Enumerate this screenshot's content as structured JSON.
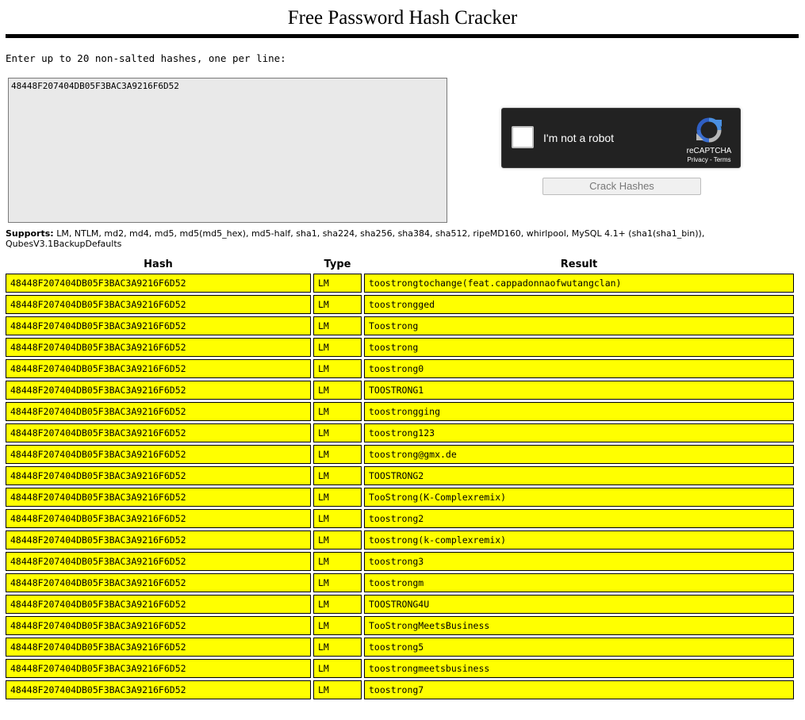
{
  "page": {
    "title": "Free Password Hash Cracker",
    "instructions": "Enter up to 20 non-salted hashes, one per line:"
  },
  "input": {
    "value": "48448F207404DB05F3BAC3A9216F6D52"
  },
  "recaptcha": {
    "label": "I'm not a robot",
    "brand": "reCAPTCHA",
    "privacy": "Privacy",
    "separator": " - ",
    "terms": "Terms",
    "icon": "recaptcha-logo-icon"
  },
  "crack_button": {
    "label": "Crack Hashes"
  },
  "supports": {
    "label": "Supports:",
    "list": " LM, NTLM, md2, md4, md5, md5(md5_hex), md5-half, sha1, sha224, sha256, sha384, sha512, ripeMD160, whirlpool, MySQL 4.1+ (sha1(sha1_bin)), QubesV3.1BackupDefaults"
  },
  "table": {
    "headers": [
      "Hash",
      "Type",
      "Result"
    ],
    "row_color": "#ffff00",
    "rows": [
      {
        "hash": "48448F207404DB05F3BAC3A9216F6D52",
        "type": "LM",
        "result": "toostrongtochange(feat.cappadonnaofwutangclan)"
      },
      {
        "hash": "48448F207404DB05F3BAC3A9216F6D52",
        "type": "LM",
        "result": "toostrongged"
      },
      {
        "hash": "48448F207404DB05F3BAC3A9216F6D52",
        "type": "LM",
        "result": "Toostrong"
      },
      {
        "hash": "48448F207404DB05F3BAC3A9216F6D52",
        "type": "LM",
        "result": "toostrong"
      },
      {
        "hash": "48448F207404DB05F3BAC3A9216F6D52",
        "type": "LM",
        "result": "toostrong0"
      },
      {
        "hash": "48448F207404DB05F3BAC3A9216F6D52",
        "type": "LM",
        "result": "TOOSTRONG1"
      },
      {
        "hash": "48448F207404DB05F3BAC3A9216F6D52",
        "type": "LM",
        "result": "toostrongging"
      },
      {
        "hash": "48448F207404DB05F3BAC3A9216F6D52",
        "type": "LM",
        "result": "toostrong123"
      },
      {
        "hash": "48448F207404DB05F3BAC3A9216F6D52",
        "type": "LM",
        "result": "toostrong@gmx.de"
      },
      {
        "hash": "48448F207404DB05F3BAC3A9216F6D52",
        "type": "LM",
        "result": "TOOSTRONG2"
      },
      {
        "hash": "48448F207404DB05F3BAC3A9216F6D52",
        "type": "LM",
        "result": "TooStrong(K-Complexremix)"
      },
      {
        "hash": "48448F207404DB05F3BAC3A9216F6D52",
        "type": "LM",
        "result": "toostrong2"
      },
      {
        "hash": "48448F207404DB05F3BAC3A9216F6D52",
        "type": "LM",
        "result": "toostrong(k-complexremix)"
      },
      {
        "hash": "48448F207404DB05F3BAC3A9216F6D52",
        "type": "LM",
        "result": "toostrong3"
      },
      {
        "hash": "48448F207404DB05F3BAC3A9216F6D52",
        "type": "LM",
        "result": "toostrongm"
      },
      {
        "hash": "48448F207404DB05F3BAC3A9216F6D52",
        "type": "LM",
        "result": "TOOSTRONG4U"
      },
      {
        "hash": "48448F207404DB05F3BAC3A9216F6D52",
        "type": "LM",
        "result": "TooStrongMeetsBusiness"
      },
      {
        "hash": "48448F207404DB05F3BAC3A9216F6D52",
        "type": "LM",
        "result": "toostrong5"
      },
      {
        "hash": "48448F207404DB05F3BAC3A9216F6D52",
        "type": "LM",
        "result": "toostrongmeetsbusiness"
      },
      {
        "hash": "48448F207404DB05F3BAC3A9216F6D52",
        "type": "LM",
        "result": "toostrong7"
      }
    ]
  }
}
